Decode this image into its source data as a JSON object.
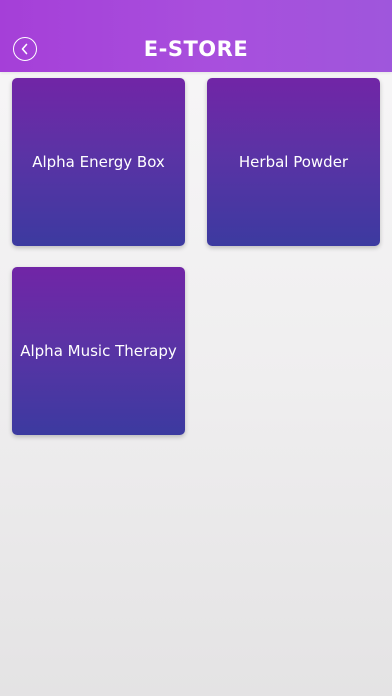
{
  "header": {
    "title": "E-STORE",
    "back_icon": "chevron-left-circle-icon"
  },
  "products": [
    {
      "label": "Alpha Energy Box"
    },
    {
      "label": "Herbal Powder"
    },
    {
      "label": "Alpha Music Therapy"
    }
  ]
}
